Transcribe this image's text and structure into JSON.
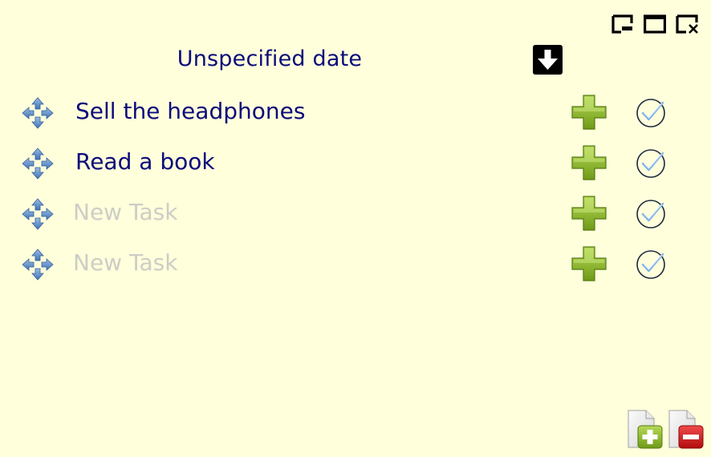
{
  "header": {
    "title": "Unspecified date",
    "sort_icon": "arrow-down-icon"
  },
  "window_controls": [
    {
      "name": "restore",
      "icon": "restore-window-icon"
    },
    {
      "name": "maximize",
      "icon": "maximize-window-icon"
    },
    {
      "name": "close",
      "icon": "close-window-icon"
    }
  ],
  "tasks": [
    {
      "text": "Sell the headphones",
      "is_placeholder": false
    },
    {
      "text": "Read a book",
      "is_placeholder": false
    },
    {
      "text": "New Task",
      "is_placeholder": true
    },
    {
      "text": "New Task",
      "is_placeholder": true
    }
  ],
  "row_icons": {
    "move": "move-arrows-icon",
    "add": "green-plus-icon",
    "complete": "check-circle-icon"
  },
  "footer": {
    "add_list_icon": "document-add-icon",
    "remove_list_icon": "document-remove-icon"
  },
  "colors": {
    "background": "#ffffdc",
    "task_text": "#0b0b7a",
    "placeholder_text": "#cdcdc6",
    "plus_green": "#8db52c",
    "remove_red": "#d11a1a"
  }
}
